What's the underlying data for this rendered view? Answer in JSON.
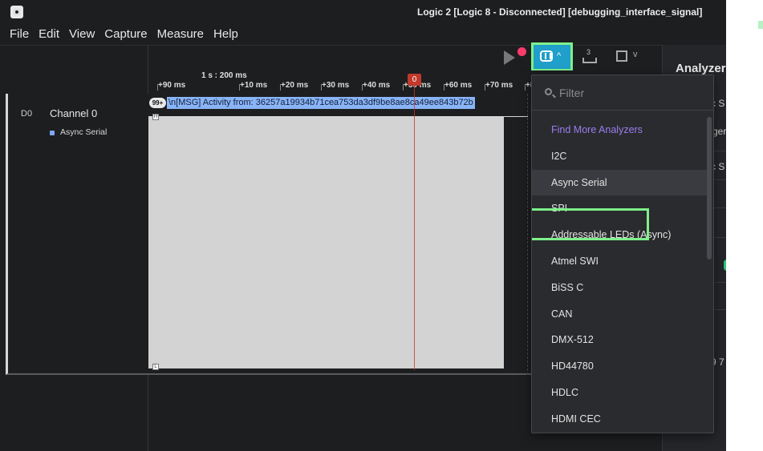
{
  "window": {
    "title": "Logic 2 [Logic 8 - Disconnected] [debugging_interface_signal]"
  },
  "menu": [
    "File",
    "Edit",
    "View",
    "Capture",
    "Measure",
    "Help"
  ],
  "toolbar": {
    "measure_badge": "3"
  },
  "ruler": {
    "scale": "1 s : 200 ms",
    "ticks": [
      "+90 ms",
      "+10 ms",
      "+20 ms",
      "+30 ms",
      "+40 ms",
      "+50 ms",
      "+60 ms",
      "+70 ms",
      "+8"
    ],
    "marker_label": "0"
  },
  "channel": {
    "id": "D0",
    "name": "Channel 0",
    "analyzer": "Async Serial",
    "data_count": "99+",
    "data_text": "\\n[MSG] Activity from: 36257a19934b71cea753da3df9be8ae8ca49ee843b72b",
    "edge_high": "H",
    "edge_low": "L"
  },
  "right_panel": {
    "heading": "Analyzers",
    "fragments": [
      "c S",
      "ger",
      "c S",
      "9 7"
    ]
  },
  "dropdown": {
    "filter_placeholder": "Filter",
    "find_more": "Find More Analyzers",
    "items": [
      "I2C",
      "Async Serial",
      "SPI",
      "Addressable LEDs (Async)",
      "Atmel SWI",
      "BiSS C",
      "CAN",
      "DMX-512",
      "HD44780",
      "HDLC",
      "HDMI CEC"
    ],
    "selected": "Async Serial"
  },
  "colors": {
    "accent_green": "#7ef08a",
    "analyzer_button": "#1f9fc9",
    "find_more": "#9b7ef0",
    "marker": "#c0392b",
    "data_bubble": "#8ab4f8"
  }
}
